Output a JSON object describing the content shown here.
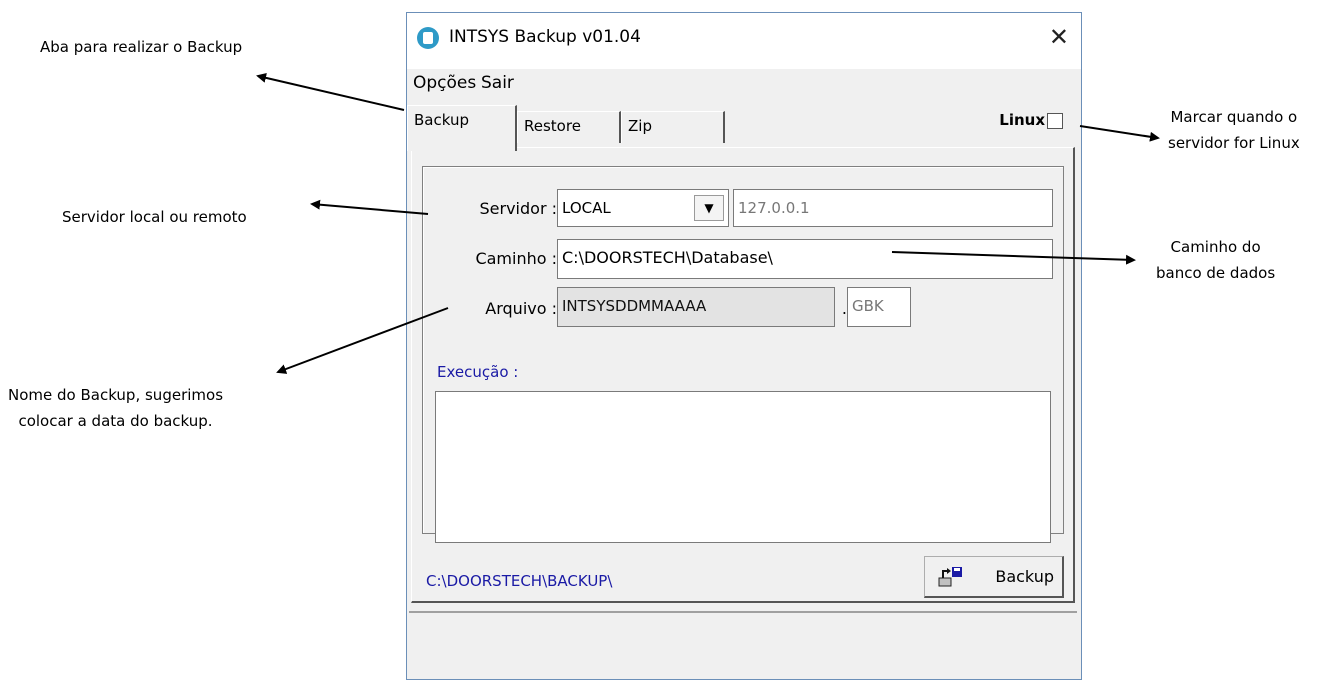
{
  "annotations": {
    "tab_note": "Aba para realizar o Backup",
    "server_note": "Servidor local ou remoto",
    "name_note_line1": "Nome do Backup, sugerimos",
    "name_note_line2": "colocar a data do backup.",
    "linux_note_line1": "Marcar quando o",
    "linux_note_line2": "servidor for Linux",
    "path_note_line1": "Caminho do",
    "path_note_line2": "banco de dados"
  },
  "window": {
    "title": "INTSYS Backup v01.04",
    "close_glyph": "✕",
    "icon": "intsys-app-icon"
  },
  "menu": {
    "options": "Opções",
    "exit": "Sair"
  },
  "tabs": [
    "Backup",
    "Restore",
    "Zip"
  ],
  "linux": {
    "label": "Linux",
    "checked": false
  },
  "form": {
    "server_label": "Servidor :",
    "server_select": "LOCAL",
    "server_ip": "127.0.0.1",
    "path_label": "Caminho :",
    "path_value": "C:\\DOORSTECH\\Database\\",
    "file_label": "Arquivo :",
    "file_value": "INTSYSDDMMAAAA",
    "file_dot": ".",
    "file_ext": "GBK"
  },
  "execution_label": "Execução :",
  "backup_path": "C:\\DOORSTECH\\BACKUP\\",
  "backup_button": "Backup",
  "colors": {
    "link_blue": "#1a1aa5",
    "window_bg": "#f0f0f0",
    "icon_blue": "#2e9ac7"
  }
}
